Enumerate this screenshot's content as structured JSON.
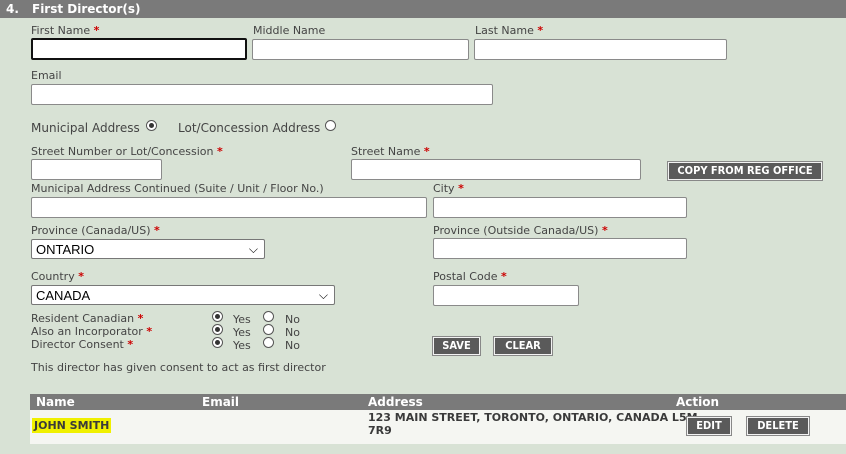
{
  "section": {
    "number": "4.",
    "title": "First Director(s)"
  },
  "fields": {
    "first_name": {
      "label": "First Name",
      "value": ""
    },
    "middle_name": {
      "label": "Middle Name",
      "value": ""
    },
    "last_name": {
      "label": "Last Name",
      "value": ""
    },
    "email": {
      "label": "Email",
      "value": ""
    },
    "street_number": {
      "label": "Street Number or Lot/Concession",
      "value": ""
    },
    "street_name": {
      "label": "Street Name",
      "value": ""
    },
    "address_continued": {
      "label": "Municipal Address Continued (Suite / Unit / Floor No.)",
      "value": ""
    },
    "city": {
      "label": "City",
      "value": ""
    },
    "province": {
      "label": "Province (Canada/US)",
      "value": "ONTARIO"
    },
    "province_outside": {
      "label": "Province (Outside Canada/US)",
      "value": ""
    },
    "country": {
      "label": "Country",
      "value": "CANADA"
    },
    "postal_code": {
      "label": "Postal Code",
      "value": ""
    }
  },
  "address_type": {
    "municipal_label": "Municipal Address",
    "lot_label": "Lot/Concession Address",
    "selected": "municipal"
  },
  "questions": {
    "resident": {
      "label": "Resident Canadian",
      "selected": "Yes"
    },
    "incorporator": {
      "label": "Also an Incorporator",
      "selected": "Yes"
    },
    "consent": {
      "label": "Director Consent",
      "selected": "Yes"
    },
    "yes_label": "Yes",
    "no_label": "No"
  },
  "consent_note": "This director has given consent to act as first director",
  "buttons": {
    "copy": "COPY FROM REG OFFICE",
    "save": "SAVE",
    "clear": "CLEAR",
    "edit": "EDIT",
    "delete": "DELETE"
  },
  "table": {
    "headers": {
      "name": "Name",
      "email": "Email",
      "address": "Address",
      "action": "Action"
    },
    "rows": [
      {
        "name": "JOHN SMITH",
        "email": "",
        "address_line1": "123 MAIN STREET, TORONTO, ONTARIO, CANADA L5M",
        "address_line2": "7R9"
      }
    ]
  },
  "required_mark": "*",
  "colors": {
    "background": "#d8e2d5",
    "header": "#7a7a7a",
    "button": "#5a5a5a",
    "required": "#cc0000",
    "highlight": "#f0f000"
  }
}
